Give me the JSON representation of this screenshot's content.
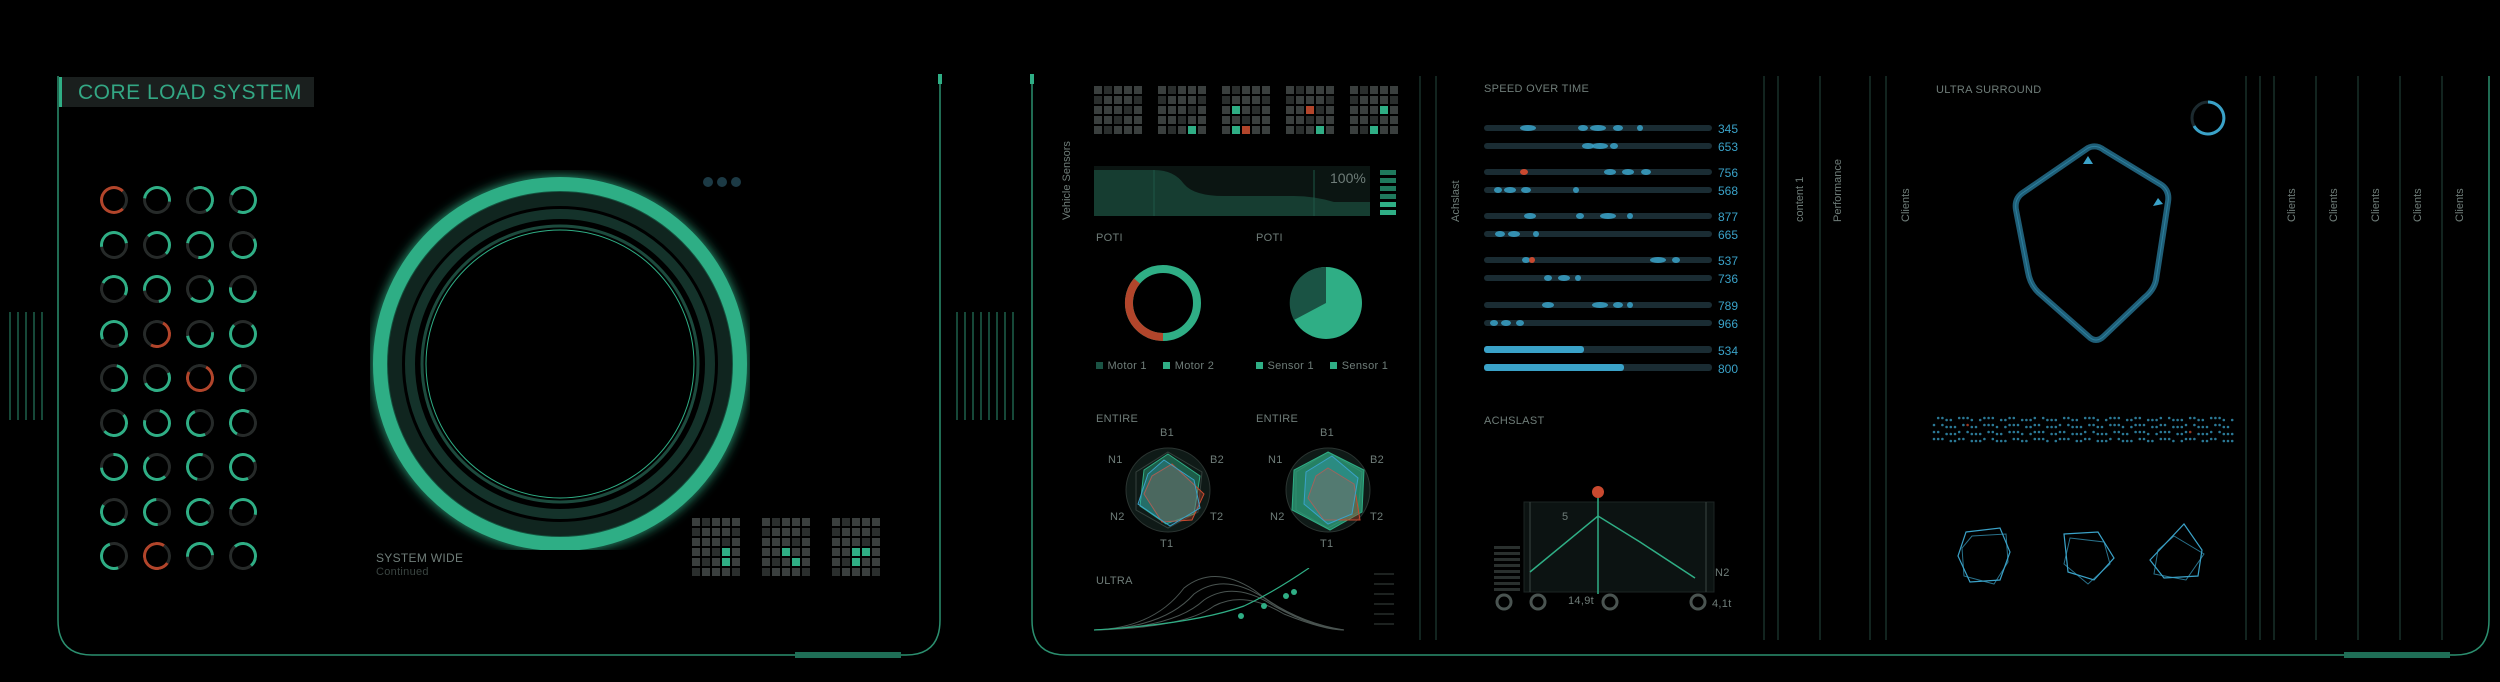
{
  "colors": {
    "accent": "#2fae85",
    "blue": "#3aa2c8",
    "red": "#c9492f",
    "frame": "#2b8f6f"
  },
  "left_panel": {
    "title": "CORE LOAD SYSTEM",
    "system_wide": "SYSTEM WIDE",
    "system_sub": "Continued"
  },
  "sensors": {
    "vehicle_label": "Vehicle Sensors",
    "level_percent": "100%",
    "poti_left": {
      "title": "POTI",
      "legend": [
        "Motor 1",
        "Motor 2"
      ]
    },
    "poti_right": {
      "title": "POTI",
      "legend": [
        "Sensor 1",
        "Sensor 1"
      ]
    },
    "entire_left": {
      "title": "ENTIRE",
      "axes": [
        "B1",
        "B2",
        "T2",
        "T1",
        "N2",
        "N1"
      ]
    },
    "entire_right": {
      "title": "ENTIRE",
      "axes": [
        "B1",
        "B2",
        "T2",
        "T1",
        "N2",
        "N1"
      ]
    },
    "ultra": "ULTRA"
  },
  "speed": {
    "side_label": "Achslast",
    "title": "SPEED OVER TIME",
    "values": [
      "345",
      "653",
      "756",
      "568",
      "877",
      "665",
      "537",
      "736",
      "789",
      "966",
      "534",
      "800"
    ],
    "achslast_title": "ACHSLAST",
    "chart_mark": "5",
    "axis_label_n2": "N2",
    "bottom_label_a": "14,9t",
    "bottom_label_b": "4,1t"
  },
  "mid_strips": {
    "content": "content 1",
    "performance": "Performance"
  },
  "surround": {
    "clients_label": "Clients",
    "title": "ULTRA SURROUND"
  },
  "clients_columns": [
    "Clients",
    "Clients",
    "Clients",
    "Clients",
    "Clients"
  ]
}
